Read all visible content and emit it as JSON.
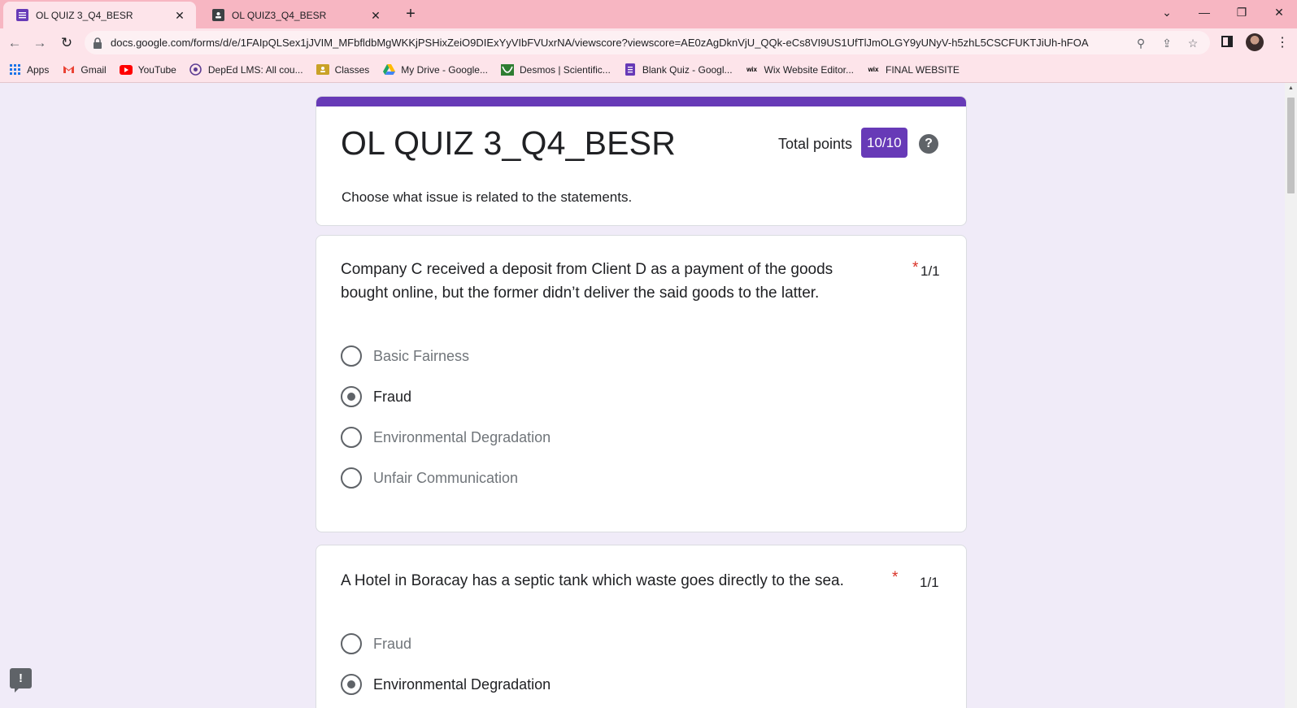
{
  "browser": {
    "tabs": [
      {
        "title": "OL QUIZ 3_Q4_BESR",
        "active": true
      },
      {
        "title": "OL QUIZ3_Q4_BESR",
        "active": false
      }
    ],
    "url": "docs.google.com/forms/d/e/1FAIpQLSex1jJVIM_MFbfldbMgWKKjPSHixZeiO9DIExYyVIbFVUxrNA/viewscore?viewscore=AE0zAgDknVjU_QQk-eCs8VI9US1UfTlJmOLGY9yUNyV-h5zhL5CSCFUKTJiUh-hFOA",
    "bookmarks": [
      {
        "label": "Apps",
        "icon": "apps-grid-icon",
        "color": "#1a73e8"
      },
      {
        "label": "Gmail",
        "icon": "gmail-icon",
        "color": "#ea4335"
      },
      {
        "label": "YouTube",
        "icon": "youtube-icon",
        "color": "#ff0000"
      },
      {
        "label": "DepEd LMS: All cou...",
        "icon": "deped-icon",
        "color": "#5c3c92"
      },
      {
        "label": "Classes",
        "icon": "classroom-icon",
        "color": "#c9a227"
      },
      {
        "label": "My Drive - Google...",
        "icon": "drive-icon",
        "color": "#1fa463"
      },
      {
        "label": "Desmos | Scientific...",
        "icon": "desmos-icon",
        "color": "#2e7d32"
      },
      {
        "label": "Blank Quiz - Googl...",
        "icon": "forms-icon",
        "color": "#673ab7"
      },
      {
        "label": "Wix Website Editor...",
        "icon": "wix-icon",
        "color": "#000000"
      },
      {
        "label": "FINAL WEBSITE",
        "icon": "wix-icon",
        "color": "#000000"
      }
    ]
  },
  "form": {
    "title": "OL QUIZ 3_Q4_BESR",
    "description": "Choose what issue is related to the statements.",
    "total_points_label": "Total points",
    "score": "10/10",
    "help_glyph": "?",
    "accent_color": "#673ab7"
  },
  "questions": [
    {
      "text": "Company C received a deposit from Client D as a payment of the goods bought online, but the former didn’t deliver the said goods to the latter.",
      "required_mark": "*",
      "points": "1/1",
      "options": [
        {
          "label": "Basic Fairness",
          "selected": false
        },
        {
          "label": "Fraud",
          "selected": true
        },
        {
          "label": "Environmental Degradation",
          "selected": false
        },
        {
          "label": "Unfair Communication",
          "selected": false
        }
      ]
    },
    {
      "text": "A Hotel in Boracay has a septic tank which waste goes directly to the sea.",
      "required_mark": "*",
      "points": "1/1",
      "options": [
        {
          "label": "Fraud",
          "selected": false
        },
        {
          "label": "Environmental Degradation",
          "selected": true
        }
      ]
    }
  ],
  "feedback_glyph": "!"
}
